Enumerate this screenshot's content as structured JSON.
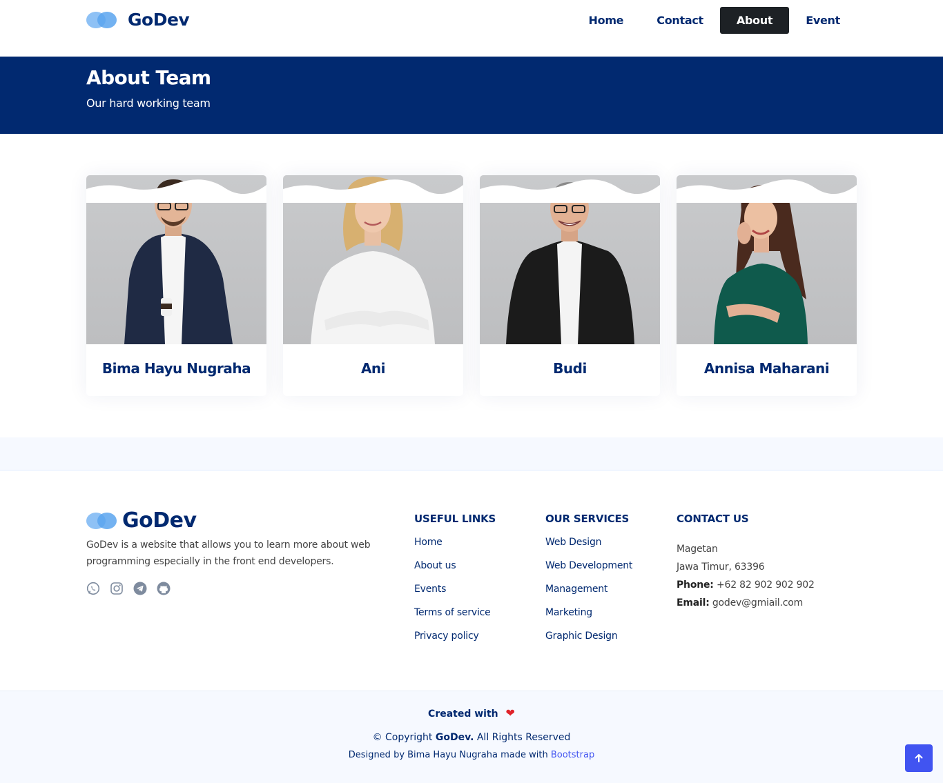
{
  "brand": {
    "name": "GoDev"
  },
  "nav": [
    {
      "label": "Home",
      "active": false
    },
    {
      "label": "Contact",
      "active": false
    },
    {
      "label": "About",
      "active": true
    },
    {
      "label": "Event",
      "active": false
    }
  ],
  "banner": {
    "title": "About Team",
    "subtitle": "Our hard working team"
  },
  "team": [
    {
      "name": "Bima Hayu Nugraha"
    },
    {
      "name": "Ani"
    },
    {
      "name": "Budi"
    },
    {
      "name": "Annisa Maharani"
    }
  ],
  "footer": {
    "logo_text": "GoDev",
    "description": "GoDev is a website that allows you to learn more about web programming especially in the front end developers.",
    "socials": [
      "whatsapp-icon",
      "instagram-icon",
      "telegram-icon",
      "github-icon"
    ],
    "useful_links": {
      "title": "USEFUL LINKS",
      "items": [
        "Home",
        "About us",
        "Events",
        "Terms of service",
        "Privacy policy"
      ]
    },
    "services": {
      "title": "OUR SERVICES",
      "items": [
        "Web Design",
        "Web Development",
        "Management",
        "Marketing",
        "Graphic Design"
      ]
    },
    "contact": {
      "title": "CONTACT US",
      "city": "Magetan",
      "region": "Jawa Timur, 63396",
      "phone_label": "Phone:",
      "phone": "+62 82 902 902 902",
      "email_label": "Email:",
      "email": "godev@gmiail.com"
    },
    "created_with": "Created with",
    "copyright_prefix": "© Copyright",
    "copyright_brand": "GoDev.",
    "copyright_suffix": "All Rights Reserved",
    "designed_by": "Designed by Bima Hayu Nugraha made with",
    "designed_link": "Bootstrap"
  },
  "colors": {
    "primary": "#012970",
    "accent": "#4154f1",
    "heart": "#e0242b"
  }
}
